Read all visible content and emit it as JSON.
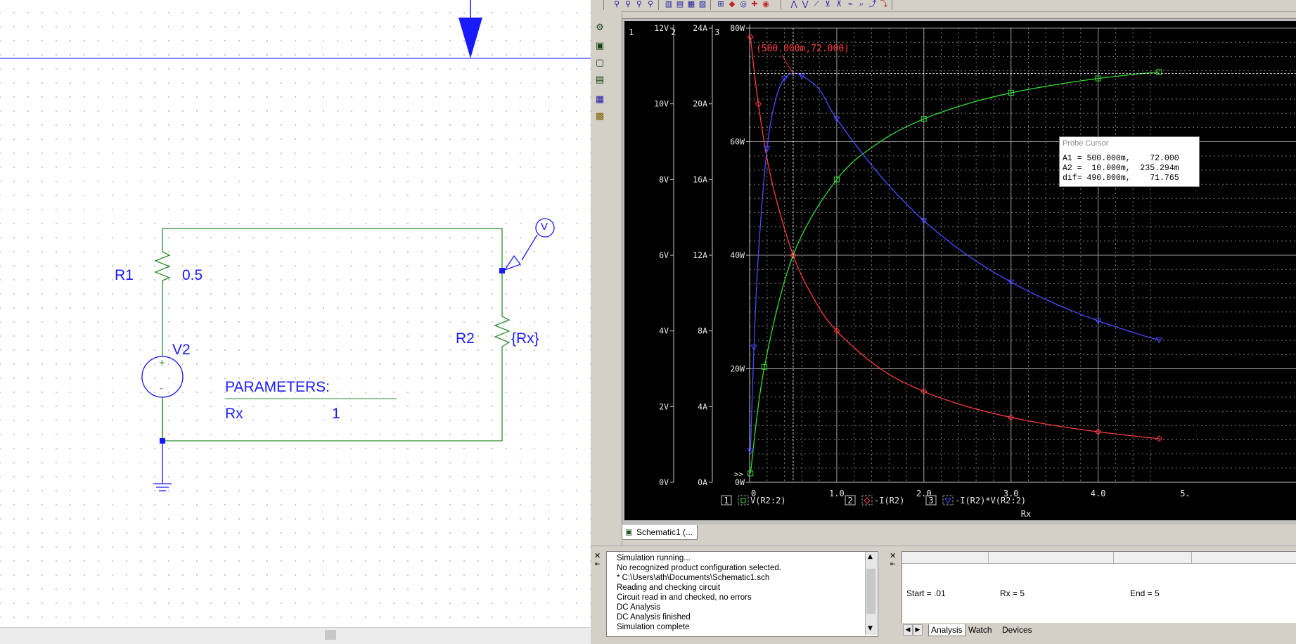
{
  "schematic": {
    "r1_ref": "R1",
    "r1_value": "0.5",
    "v2_ref": "V2",
    "r2_ref": "R2",
    "r2_value": "{Rx}",
    "probe_marker": "V",
    "plus_sign": "+",
    "minus_sign": "-",
    "params_title": "PARAMETERS:",
    "params_name": "Rx",
    "params_value": "1",
    "wire_color": "#2c8c2c",
    "part_color": "#1a1aff"
  },
  "probe": {
    "tab_label": "Schematic1 (...",
    "cursor": {
      "title": "Probe Cursor",
      "row_a1": "A1 = 500.000m,    72.000",
      "row_a2": "A2 =  10.000m,  235.294m",
      "row_dif": "dif= 490.000m,    71.765"
    },
    "cursor_label": "(500.000m,72.000)"
  },
  "output_log": {
    "lines": [
      "Simulation running...",
      "No recognized product configuration selected.",
      "* C:\\Users\\ath\\Documents\\Schematic1.sch",
      "Reading and checking circuit",
      "Circuit read in and checked, no errors",
      "DC Analysis",
      "DC Analysis finished",
      "Simulation complete"
    ]
  },
  "sim_status": {
    "start": "Start = .01",
    "rx": "Rx =  5",
    "end": "End = 5",
    "tabs": [
      "Analysis",
      "Watch",
      "Devices"
    ]
  },
  "chart_data": {
    "type": "line",
    "xlabel": "Rx",
    "x_ticks": [
      "0",
      "1.0",
      "2.0",
      "3.0",
      "4.0",
      "5."
    ],
    "xlim": [
      0,
      4.7
    ],
    "axes": [
      {
        "id": "1",
        "unit": "V",
        "ylim": [
          0,
          12
        ],
        "ticks": [
          "0V",
          "2V",
          "4V",
          "6V",
          "8V",
          "10V",
          "12V"
        ]
      },
      {
        "id": "2",
        "unit": "A",
        "ylim": [
          0,
          24
        ],
        "ticks": [
          "0A",
          "4A",
          "8A",
          "12A",
          "16A",
          "20A",
          "24A"
        ]
      },
      {
        "id": "3",
        "unit": "W",
        "ylim": [
          0,
          80
        ],
        "ticks": [
          "0W",
          "20W",
          "40W",
          "60W",
          "80W"
        ]
      }
    ],
    "series": [
      {
        "name": "V(R2:2)",
        "axis": "1",
        "color": "#33dd33",
        "marker": "square",
        "x": [
          0.01,
          0.17,
          0.5,
          1.0,
          1.5,
          2.0,
          2.5,
          3.0,
          3.5,
          4.0,
          4.5,
          4.7
        ],
        "y": [
          0.235,
          3.05,
          6.0,
          8.0,
          9.0,
          9.6,
          10.0,
          10.29,
          10.5,
          10.67,
          10.8,
          10.84
        ]
      },
      {
        "name": "-I(R2)",
        "axis": "2",
        "color": "#ff3b3b",
        "marker": "diamond",
        "x": [
          0.01,
          0.1,
          0.25,
          0.5,
          0.75,
          1.0,
          1.5,
          2.0,
          2.5,
          3.0,
          3.5,
          4.0,
          4.5,
          4.7
        ],
        "y": [
          23.53,
          20.0,
          16.0,
          12.0,
          9.6,
          8.0,
          6.0,
          4.8,
          4.0,
          3.43,
          3.0,
          2.67,
          2.4,
          2.31
        ]
      },
      {
        "name": "-I(R2)*V(R2:2)",
        "axis": "3",
        "color": "#4a4aff",
        "marker": "triangle",
        "x": [
          0.01,
          0.05,
          0.1,
          0.2,
          0.3,
          0.4,
          0.5,
          0.6,
          0.8,
          1.0,
          1.5,
          2.0,
          2.5,
          3.0,
          3.5,
          4.0,
          4.5,
          4.7
        ],
        "y": [
          5.54,
          23.8,
          40.0,
          58.78,
          67.5,
          71.1,
          72.0,
          71.6,
          69.2,
          64.0,
          54.0,
          46.08,
          40.0,
          35.27,
          31.5,
          28.44,
          25.92,
          25.06
        ]
      }
    ],
    "legend": [
      {
        "index": "1",
        "label": "V(R2:2)"
      },
      {
        "index": "2",
        "label": "-I(R2)"
      },
      {
        "index": "3",
        "label": "-I(R2)*V(R2:2)"
      }
    ],
    "cursor": {
      "x": 0.5,
      "y": 72.0
    },
    "grid": true
  }
}
